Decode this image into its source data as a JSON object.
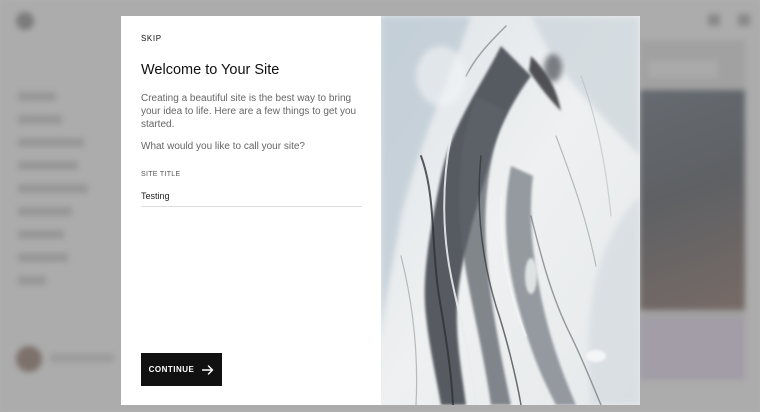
{
  "modal": {
    "skip_label": "SKIP",
    "title": "Welcome to Your Site",
    "intro": "Creating a beautiful site is the best way to bring your idea to life. Here are a few things to get you started.",
    "question": "What would you like to call your site?",
    "field_label": "SITE TITLE",
    "site_title_value": "Testing",
    "continue_label": "CONTINUE",
    "continue_icon": "arrow-right-icon",
    "image": "marble-abstract-image"
  },
  "colors": {
    "button_bg": "#111111",
    "overlay": "#808080"
  }
}
